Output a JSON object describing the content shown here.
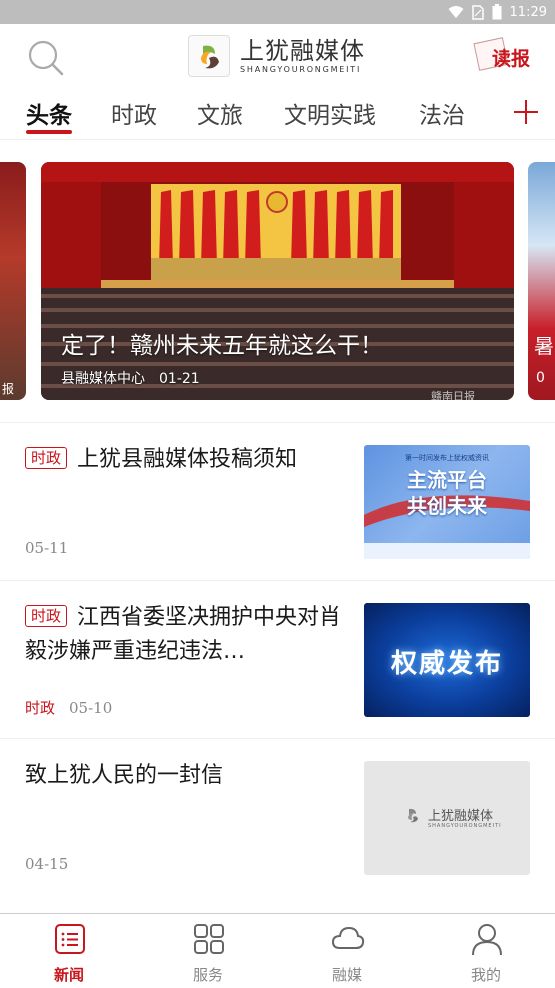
{
  "status_bar": {
    "time": "11:29"
  },
  "header": {
    "app_name": "上犹融媒体",
    "app_name_en": "SHANGYOURONGMEITI",
    "read_label": "读报"
  },
  "tabs": [
    {
      "label": "头条",
      "active": true
    },
    {
      "label": "时政"
    },
    {
      "label": "文旅"
    },
    {
      "label": "文明实践"
    },
    {
      "label": "法治"
    }
  ],
  "carousel": {
    "main": {
      "title": "定了！赣州未来五年就这么干！",
      "source": "县融媒体中心",
      "date": "01-21",
      "watermark": "赣南日报"
    },
    "left_peek_text": "报",
    "right_peek_text": "暑",
    "right_peek_text2": "0"
  },
  "news": [
    {
      "tag": "时政",
      "title": "上犹县融媒体投稿须知",
      "category": "",
      "date": "05-11",
      "thumb": {
        "top_text": "第一时间发布上犹权威资讯",
        "line1": "主流平台",
        "line2": "共创未来"
      }
    },
    {
      "tag": "时政",
      "title": "江西省委坚决拥护中央对肖毅涉嫌严重违纪违法…",
      "category": "时政",
      "date": "05-10",
      "thumb": {
        "text": "权威发布"
      }
    },
    {
      "tag": "",
      "title": "致上犹人民的一封信",
      "category": "",
      "date": "04-15",
      "thumb": {
        "logo_cn": "上犹融媒体",
        "logo_en": "SHANGYOURONGMEITI"
      }
    }
  ],
  "bottom_nav": [
    {
      "label": "新闻",
      "icon": "news-icon",
      "active": true
    },
    {
      "label": "服务",
      "icon": "grid-icon"
    },
    {
      "label": "融媒",
      "icon": "cloud-icon"
    },
    {
      "label": "我的",
      "icon": "user-icon"
    }
  ],
  "colors": {
    "accent": "#c8161d",
    "status_bar": "#bdbdbd"
  }
}
